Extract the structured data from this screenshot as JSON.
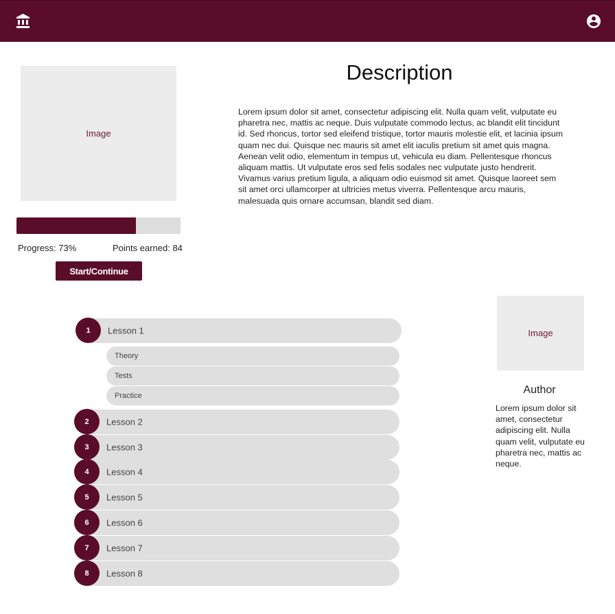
{
  "colors": {
    "primary": "#5a0d28",
    "track": "#dddddd",
    "card": "#dfdfdf",
    "placeholder": "#ececec"
  },
  "header": {
    "left_icon": "bank-icon",
    "right_icon": "account-circle-icon"
  },
  "course": {
    "image_label": "Image",
    "progress_percent": 73,
    "progress_text": "Progress: 73%",
    "points_text": "Points earned: 84",
    "start_label": "Start/Continue"
  },
  "description": {
    "title": "Description",
    "body": "Lorem ipsum dolor sit amet, consectetur adipiscing elit. Nulla quam velit, vulputate eu pharetra nec, mattis ac neque. Duis vulputate commodo lectus, ac blandit elit tincidunt id. Sed rhoncus, tortor sed eleifend tristique, tortor mauris molestie elit, et lacinia ipsum quam nec dui. Quisque nec mauris sit amet elit iaculis pretium sit amet quis magna. Aenean velit odio, elementum in tempus ut, vehicula eu diam. Pellentesque rhoncus aliquam mattis. Ut vulputate eros sed felis sodales nec vulputate justo hendrerit. Vivamus varius pretium ligula, a aliquam odio euismod sit amet. Quisque laoreet sem sit amet orci ullamcorper at ultricies metus viverra. Pellentesque arcu mauris, malesuada quis ornare accumsan, blandit sed diam."
  },
  "author": {
    "image_label": "Image",
    "title": "Author",
    "body": "Lorem ipsum dolor sit amet, consectetur adipiscing elit. Nulla quam velit, vulputate eu pharetra nec, mattis ac neque."
  },
  "lessons": [
    {
      "number": "1",
      "label": "Lesson 1",
      "subitems": [
        "Theory",
        "Tests",
        "Practice"
      ]
    },
    {
      "number": "2",
      "label": "Lesson 2"
    },
    {
      "number": "3",
      "label": "Lesson 3"
    },
    {
      "number": "4",
      "label": "Lesson 4"
    },
    {
      "number": "5",
      "label": "Lesson 5"
    },
    {
      "number": "6",
      "label": "Lesson 6"
    },
    {
      "number": "7",
      "label": "Lesson 7"
    },
    {
      "number": "8",
      "label": "Lesson 8"
    }
  ]
}
